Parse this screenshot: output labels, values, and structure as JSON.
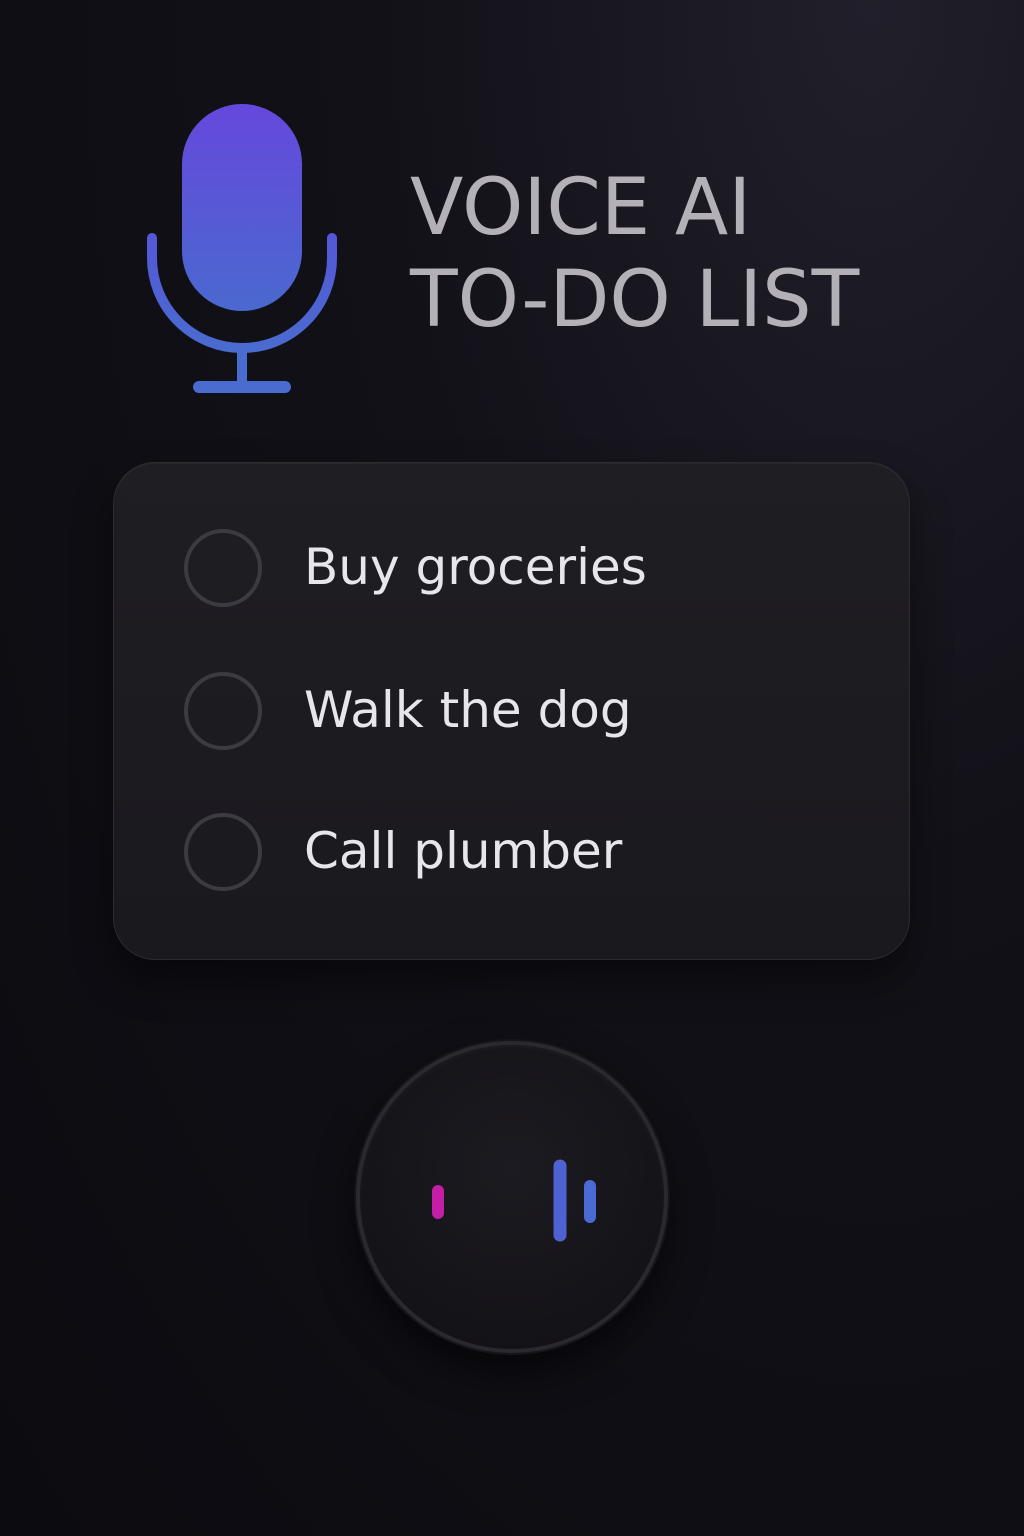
{
  "header": {
    "title_line1": "VOICE AI",
    "title_line2": "TO-DO LIST",
    "logo_icon": "microphone-icon"
  },
  "tasks": [
    {
      "label": "Buy groceries",
      "checked": false
    },
    {
      "label": "Walk the dog",
      "checked": false
    },
    {
      "label": "Call plumber",
      "checked": false
    }
  ],
  "voice_button": {
    "icon": "waveform-icon"
  },
  "colors": {
    "background": "#0b0b10",
    "card": "#1d1c21",
    "title_text": "#b3b1b7",
    "task_text": "#e7e6ea",
    "mic_gradient_top": "#6548dc",
    "mic_gradient_bottom": "#4a69cf",
    "wave_magenta": "#c41ea6",
    "wave_purple": "#6a4bc9",
    "wave_blue": "#4a6ad4"
  }
}
